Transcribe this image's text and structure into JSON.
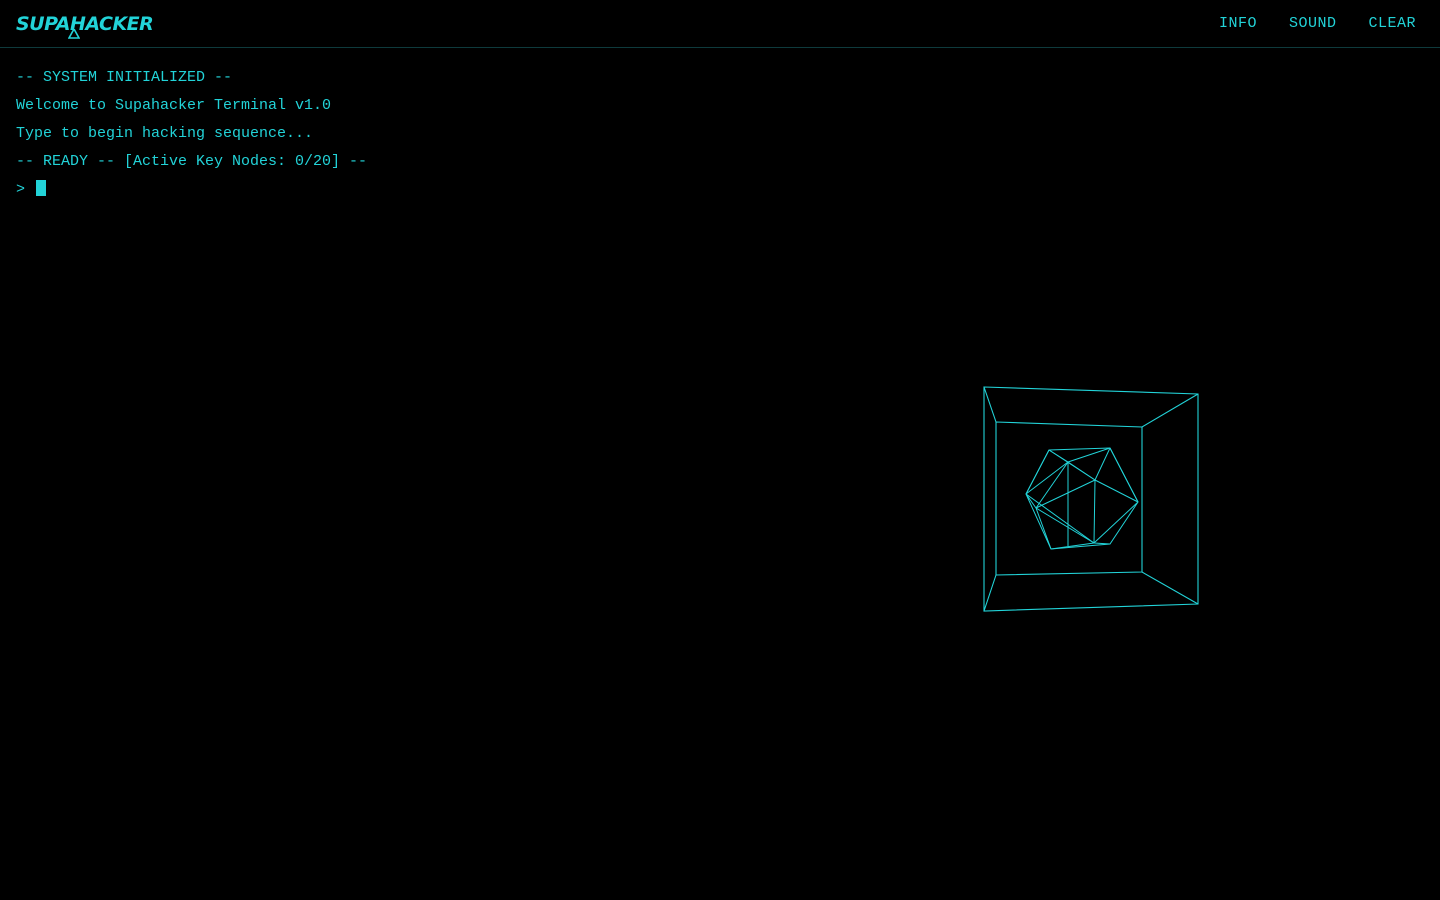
{
  "header": {
    "logo_text": "SUPAHACKER",
    "nav": [
      {
        "label": "INFO"
      },
      {
        "label": "SOUND"
      },
      {
        "label": "CLEAR"
      }
    ]
  },
  "terminal": {
    "lines": [
      "-- SYSTEM INITIALIZED --",
      "Welcome to Supahacker Terminal v1.0",
      "Type to begin hacking sequence...",
      "-- READY -- [Active Key Nodes: 0/20] --"
    ],
    "prompt_symbol": ">",
    "input_value": ""
  },
  "scene": {
    "objects": [
      "wireframe-box",
      "wireframe-icosahedron"
    ]
  },
  "colors": {
    "accent": "#22d3d8",
    "background": "#000000",
    "divider": "#0e3a3c"
  }
}
